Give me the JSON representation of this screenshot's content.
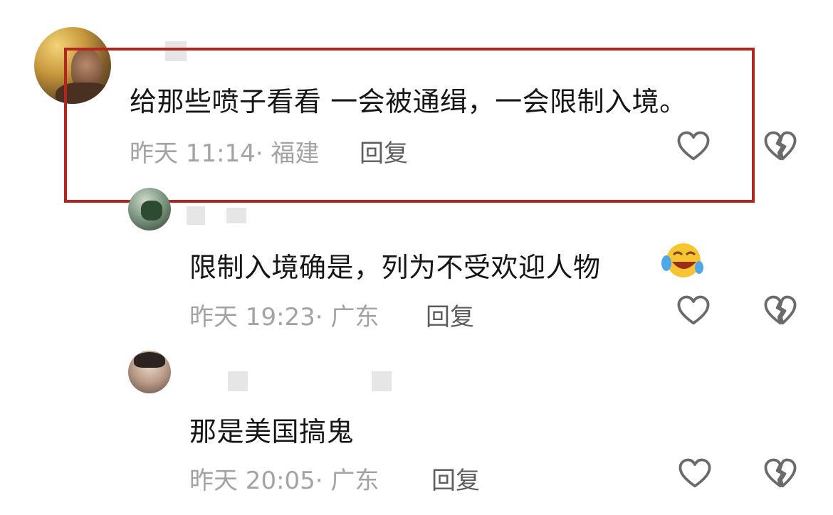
{
  "comments": [
    {
      "text": "给那些喷子看看 一会被通缉，一会限制入境。",
      "time": "昨天 11:14",
      "location": "· 福建",
      "reply_label": "回复"
    },
    {
      "text": "限制入境确是，列为不受欢迎人物",
      "time": "昨天 19:23",
      "location": "· 广东",
      "reply_label": "回复"
    },
    {
      "text": "那是美国搞鬼",
      "time": "昨天 20:05",
      "location": "· 广东",
      "reply_label": "回复"
    }
  ],
  "icons": {
    "like": "heart-outline-icon",
    "dislike": "broken-heart-icon",
    "emoji": "laughing-crying-emoji-icon"
  },
  "colors": {
    "highlight_border": "#b3261e",
    "text": "#161616",
    "meta": "#a3a3a3",
    "reply": "#5d5d5d",
    "icon": "#6a6a6a"
  }
}
